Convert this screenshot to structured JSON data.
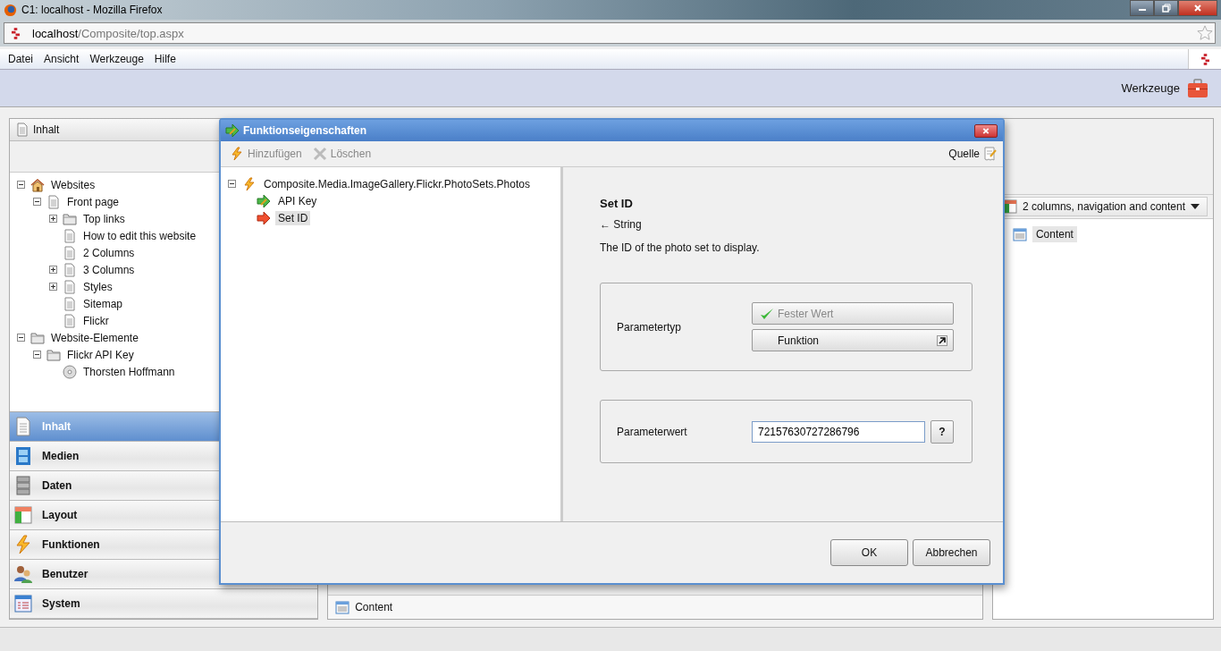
{
  "browser": {
    "title": "C1: localhost - Mozilla Firefox",
    "address": {
      "host": "localhost",
      "path": "/Composite/top.aspx"
    },
    "menu": [
      "Datei",
      "Ansicht",
      "Werkzeuge",
      "Hilfe"
    ]
  },
  "header": {
    "tools_label": "Werkzeuge"
  },
  "left_panel": {
    "tab": "Inhalt",
    "tree": [
      {
        "label": "Websites",
        "kind": "house",
        "expanded": true,
        "children": [
          {
            "label": "Front page",
            "kind": "page",
            "expanded": true,
            "children": [
              {
                "label": "Top links",
                "kind": "folder",
                "expanded": false
              },
              {
                "label": "How to edit this website",
                "kind": "page"
              },
              {
                "label": "2 Columns",
                "kind": "page"
              },
              {
                "label": "3 Columns",
                "kind": "page",
                "expanded": false
              },
              {
                "label": "Styles",
                "kind": "page",
                "expanded": false
              },
              {
                "label": "Sitemap",
                "kind": "page"
              },
              {
                "label": "Flickr",
                "kind": "page"
              }
            ]
          }
        ]
      },
      {
        "label": "Website-Elemente",
        "kind": "folder",
        "expanded": true,
        "children": [
          {
            "label": "Flickr API Key",
            "kind": "folder",
            "expanded": true,
            "children": [
              {
                "label": "Thorsten Hoffmann",
                "kind": "disc"
              }
            ]
          }
        ]
      }
    ],
    "nav": [
      {
        "label": "Inhalt",
        "kind": "page",
        "selected": true
      },
      {
        "label": "Medien",
        "kind": "film",
        "selected": false
      },
      {
        "label": "Daten",
        "kind": "data",
        "selected": false
      },
      {
        "label": "Layout",
        "kind": "layout",
        "selected": false
      },
      {
        "label": "Funktionen",
        "kind": "bolt",
        "selected": false
      },
      {
        "label": "Benutzer",
        "kind": "users",
        "selected": false
      },
      {
        "label": "System",
        "kind": "system",
        "selected": false
      }
    ]
  },
  "middle_panel": {
    "item": "Content"
  },
  "right_panel": {
    "template": "2 columns, navigation and content",
    "item": "Content"
  },
  "dialog": {
    "title": "Funktionseigenschaften",
    "toolbar": [
      {
        "label": "Hinzufügen",
        "kind": "bolt",
        "disabled": true
      },
      {
        "label": "Löschen",
        "kind": "delete",
        "disabled": true
      }
    ],
    "source_button": "Quelle",
    "tree": {
      "label": "Composite.Media.ImageGallery.Flickr.PhotoSets.Photos",
      "expanded": true,
      "children": [
        {
          "label": "API Key",
          "kind": "set",
          "selected": false
        },
        {
          "label": "Set ID",
          "kind": "unset",
          "selected": true
        }
      ]
    },
    "param": {
      "name": "Set ID",
      "type": "← String",
      "description": "The ID of the photo set to display.",
      "type_label": "Parametertyp",
      "type_options": [
        {
          "label": "Fester Wert",
          "selected": true
        },
        {
          "label": "Funktion",
          "selected": false
        }
      ],
      "value_label": "Parameterwert",
      "value": "72157630727286796",
      "help_button": "?"
    },
    "buttons": [
      "OK",
      "Abbrechen"
    ]
  }
}
